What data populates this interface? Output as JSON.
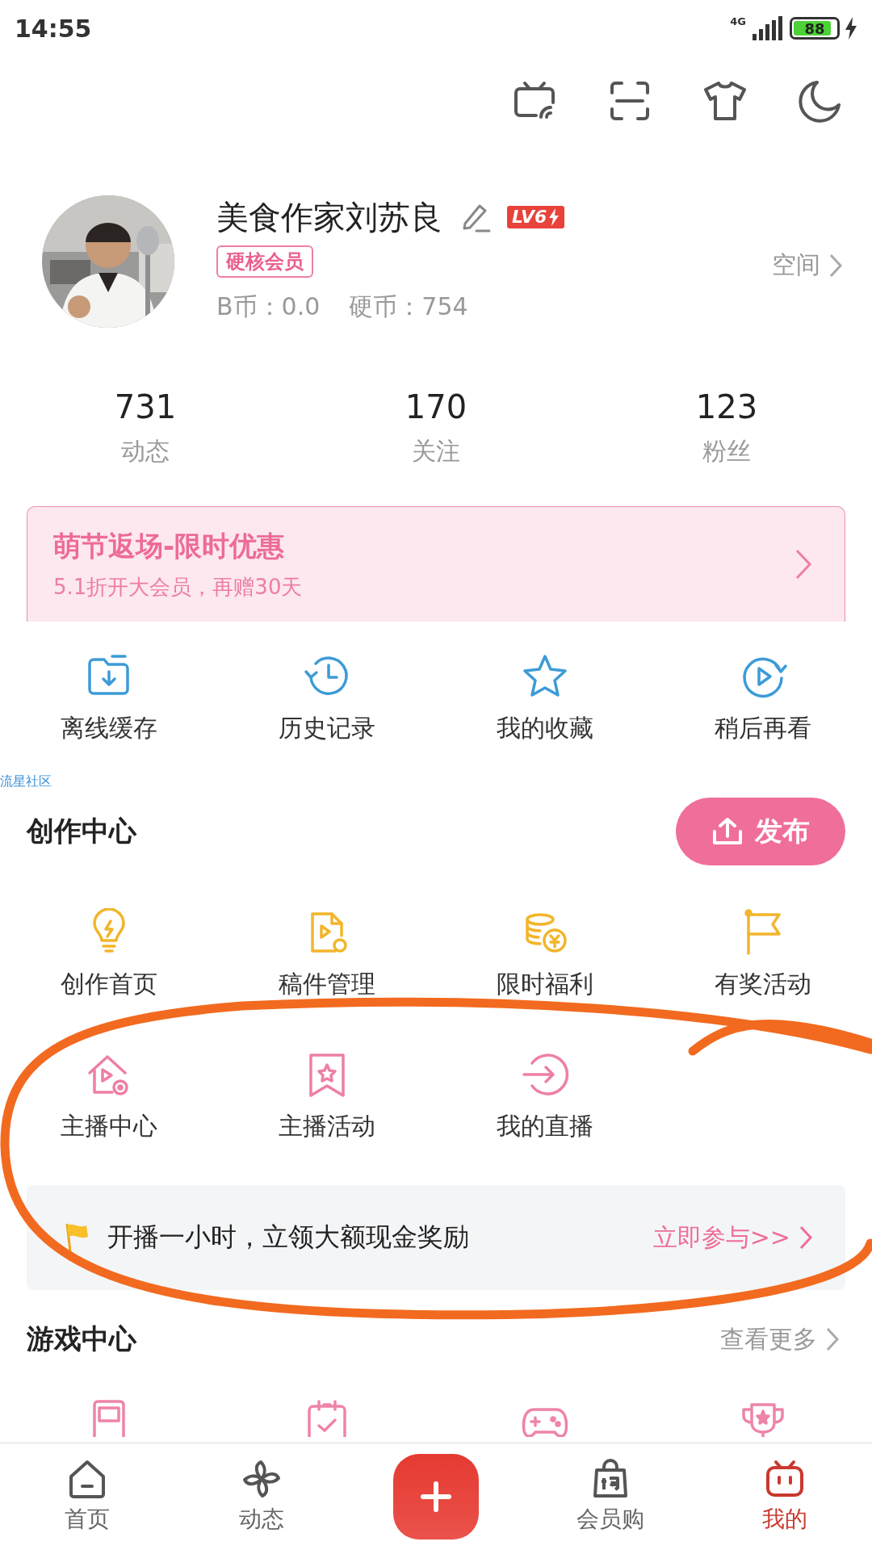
{
  "status_bar": {
    "time": "14:55",
    "network": "4G",
    "battery": "88"
  },
  "profile": {
    "name": "美食作家刘苏良",
    "level_badge": "LV6",
    "vip_tag": "硬核会员",
    "b_coins": "B币：0.0",
    "coins": "硬币：754",
    "space_link": "空间"
  },
  "stats": [
    {
      "value": "731",
      "label": "动态"
    },
    {
      "value": "170",
      "label": "关注"
    },
    {
      "value": "123",
      "label": "粉丝"
    }
  ],
  "banner": {
    "title": "萌节返场-限时优惠",
    "subtitle": "5.1折开大会员，再赠30天"
  },
  "quick_actions": [
    {
      "label": "离线缓存"
    },
    {
      "label": "历史记录"
    },
    {
      "label": "我的收藏"
    },
    {
      "label": "稍后再看"
    }
  ],
  "community_label": "流星社区",
  "creation_center": {
    "title": "创作中心",
    "publish_button": "发布",
    "items": [
      {
        "label": "创作首页",
        "color": "#f2b52b"
      },
      {
        "label": "稿件管理",
        "color": "#f2b52b"
      },
      {
        "label": "限时福利",
        "color": "#f2b52b"
      },
      {
        "label": "有奖活动",
        "color": "#f2b52b"
      },
      {
        "label": "主播中心",
        "color": "#ee7fa6"
      },
      {
        "label": "主播活动",
        "color": "#ee7fa6"
      },
      {
        "label": "我的直播",
        "color": "#ee7fa6"
      }
    ]
  },
  "live_tip": {
    "text": "开播一小时，立领大额现金奖励",
    "link": "立即参与>>"
  },
  "game_center": {
    "title": "游戏中心",
    "more": "查看更多"
  },
  "bottom_nav": [
    {
      "kind": "tab",
      "label": "首页",
      "selected": false
    },
    {
      "kind": "tab",
      "label": "动态",
      "selected": false
    },
    {
      "kind": "add"
    },
    {
      "kind": "tab",
      "label": "会员购",
      "selected": false
    },
    {
      "kind": "tab",
      "label": "我的",
      "selected": true
    }
  ]
}
